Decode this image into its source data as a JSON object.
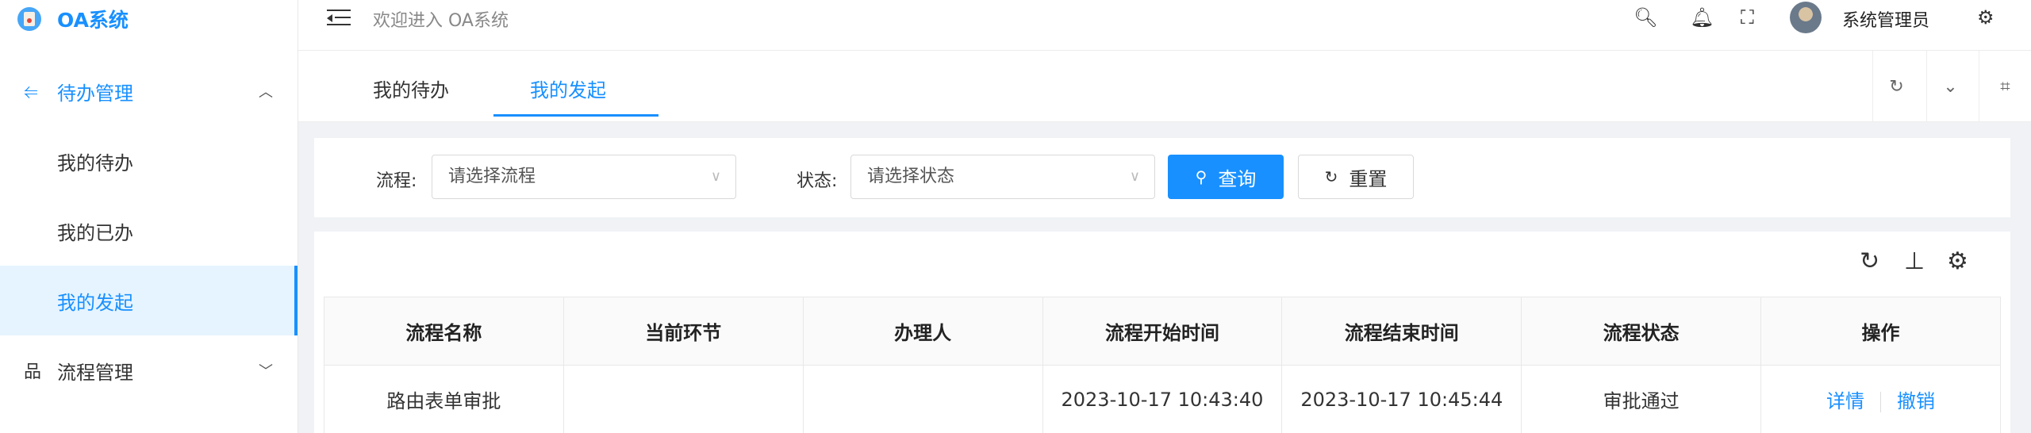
{
  "app": {
    "title": "OA系统"
  },
  "header": {
    "welcome": "欢迎进入 OA系统",
    "user_name": "系统管理员"
  },
  "sidebar": {
    "group_todo": {
      "label": "待办管理",
      "expanded": true
    },
    "items": [
      {
        "label": "我的待办"
      },
      {
        "label": "我的已办"
      },
      {
        "label": "我的发起",
        "active": true
      }
    ],
    "group_process": {
      "label": "流程管理",
      "expanded": false
    }
  },
  "tabs": [
    {
      "label": "我的待办"
    },
    {
      "label": "我的发起",
      "active": true
    }
  ],
  "search": {
    "process_label": "流程:",
    "process_placeholder": "请选择流程",
    "status_label": "状态:",
    "status_placeholder": "请选择状态",
    "query_button": "查询",
    "reset_button": "重置"
  },
  "table": {
    "columns": [
      "流程名称",
      "当前环节",
      "办理人",
      "流程开始时间",
      "流程结束时间",
      "流程状态",
      "操作"
    ],
    "rows": [
      {
        "name": "路由表单审批",
        "current_step": "",
        "handler": "",
        "start_time": "2023-10-17 10:43:40",
        "end_time": "2023-10-17 10:45:44",
        "status": "审批通过",
        "actions": [
          "详情",
          "撤销"
        ]
      }
    ]
  },
  "colors": {
    "accent": "#1890ff",
    "active_bg": "#e6f4ff",
    "page_bg": "#f0f2f5"
  }
}
